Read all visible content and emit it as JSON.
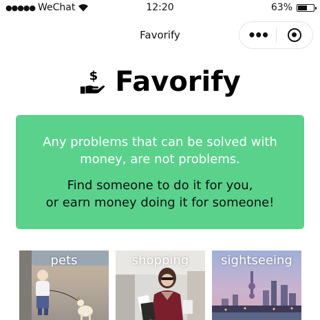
{
  "status_bar": {
    "signal_dots": "●●●●●",
    "carrier": "WeChat",
    "time": "12:20",
    "battery_percent": "63%",
    "battery_level": 0.63
  },
  "nav": {
    "title": "Favorify",
    "more_label": "•••"
  },
  "brand": {
    "icon": "hand-holding-dollar-icon",
    "name": "Favorify"
  },
  "banner": {
    "motto": "Any problems that can be solved with money, are not problems.",
    "cta_line1": "Find someone to do it for you,",
    "cta_line2": "or earn money doing it for someone!",
    "color": "#5ad28c"
  },
  "categories": [
    {
      "label": "pets"
    },
    {
      "label": "shopping"
    },
    {
      "label": "sightseeing"
    }
  ]
}
